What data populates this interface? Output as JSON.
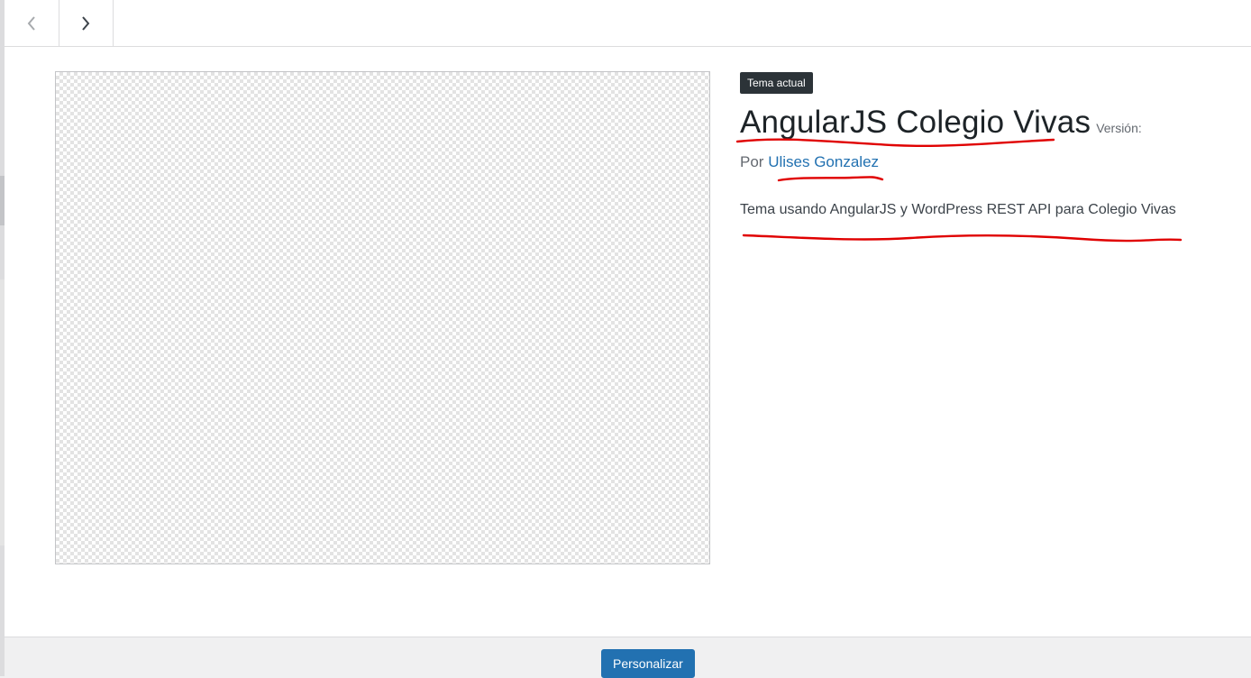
{
  "header": {
    "prev_icon": "chevron-left-icon",
    "next_icon": "chevron-right-icon"
  },
  "theme": {
    "badge": "Tema actual",
    "name": "AngularJS Colegio Vivas",
    "version_label": "Versión:",
    "author_prefix": "Por",
    "author_name": "Ulises Gonzalez",
    "description": "Tema usando AngularJS y WordPress REST API para Colegio Vivas"
  },
  "footer": {
    "customize_label": "Personalizar"
  },
  "colors": {
    "accent": "#2271b1",
    "annotation": "#e00000",
    "badge_bg": "#2c3338"
  }
}
